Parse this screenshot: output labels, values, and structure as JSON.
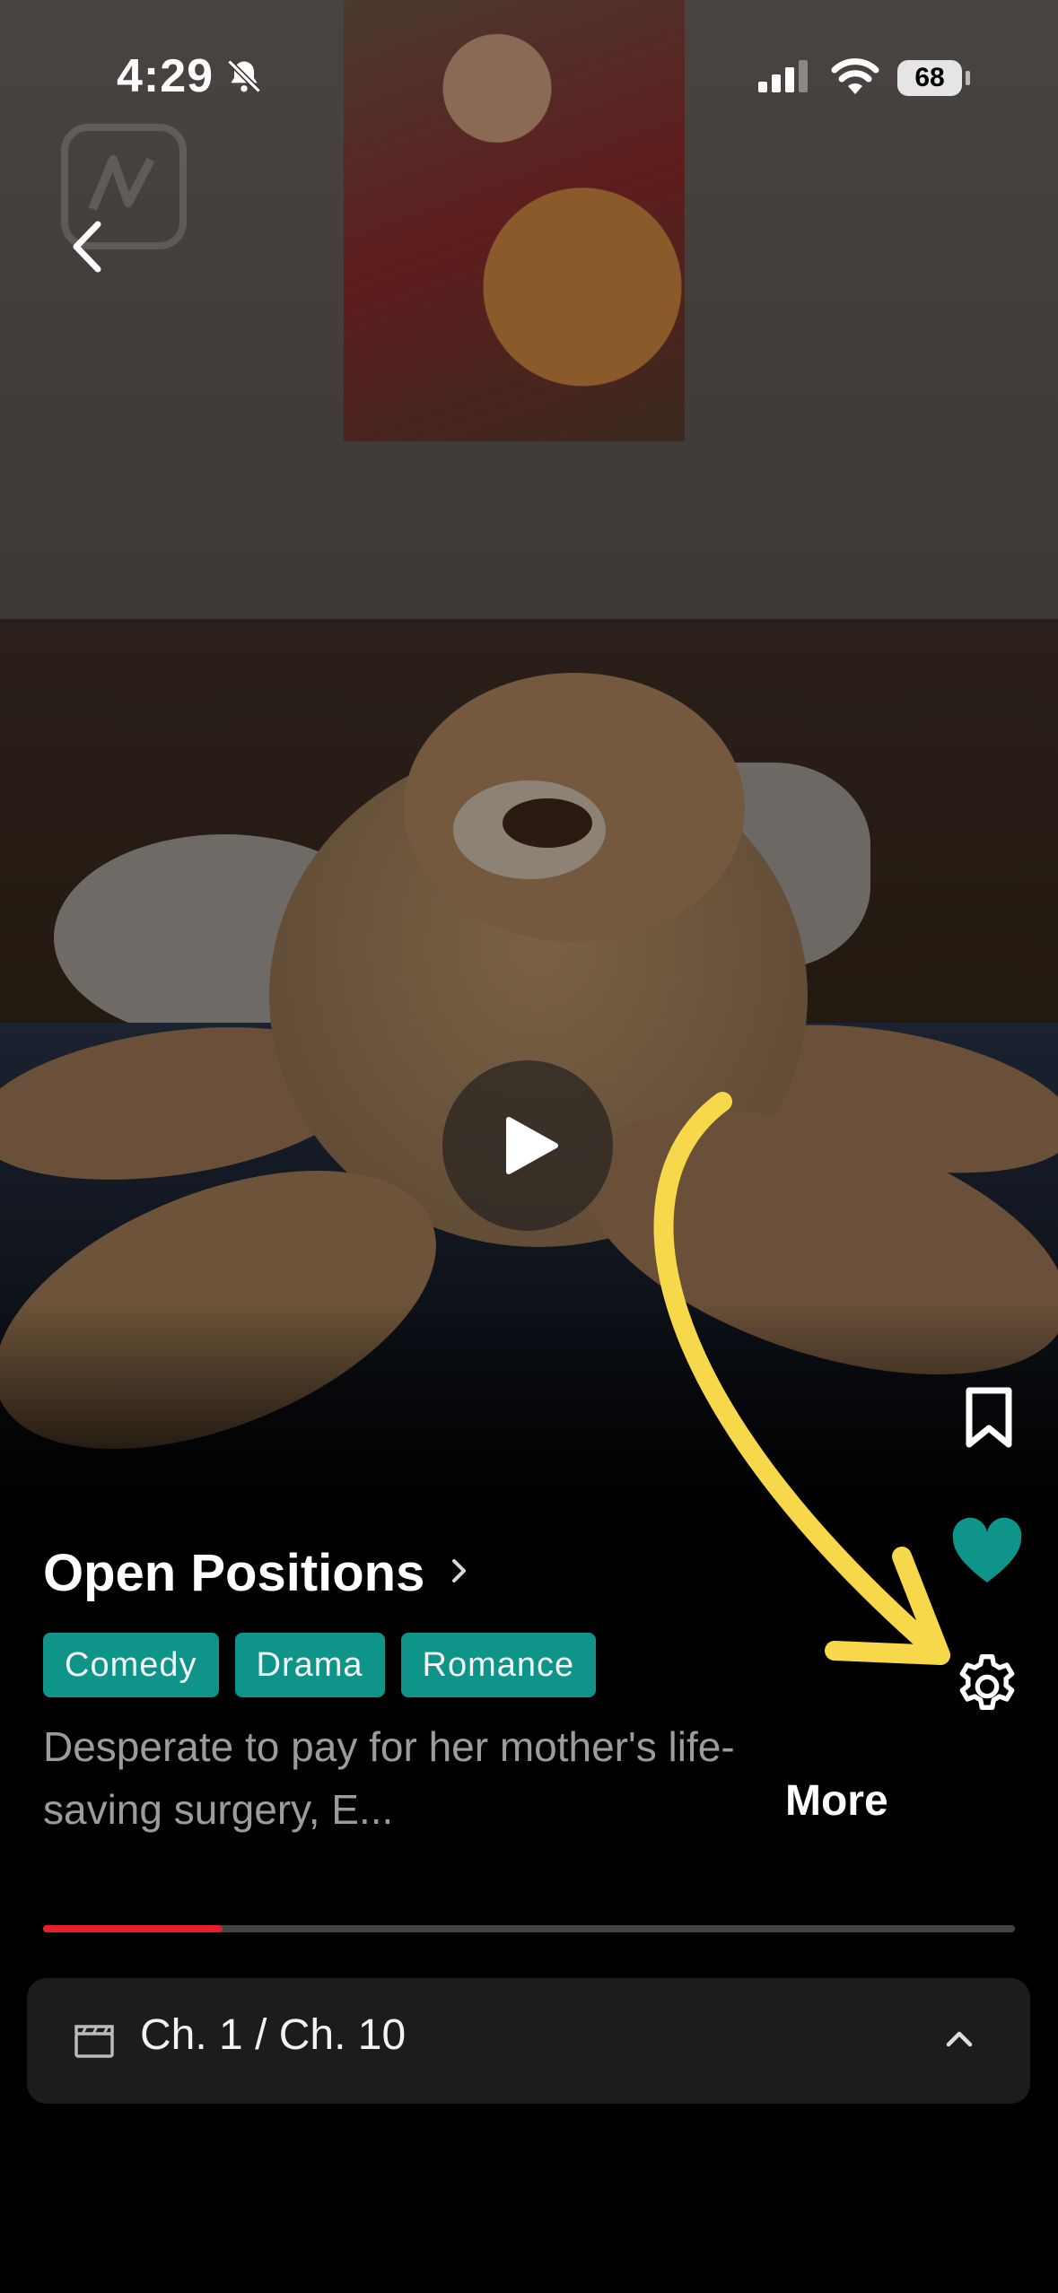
{
  "status_bar": {
    "time": "4:29",
    "battery": "68"
  },
  "show": {
    "title": "Open Positions",
    "tags": [
      "Comedy",
      "Drama",
      "Romance"
    ],
    "description": "Desperate to pay for her mother's life-saving surgery, E...",
    "more_label": "More"
  },
  "playback": {
    "progress": 0.185
  },
  "chapter": {
    "label": "Ch. 1 / Ch. 10"
  },
  "colors": {
    "accent": "#0e9488",
    "progress": "#e8202b",
    "annotation_arrow": "#f7d84a"
  },
  "icons": [
    "bell-slash-icon",
    "signal-icon",
    "wifi-icon",
    "back-chevron-icon",
    "play-icon",
    "bookmark-icon",
    "heart-icon",
    "gear-icon",
    "clapperboard-icon",
    "chevron-up-icon"
  ]
}
